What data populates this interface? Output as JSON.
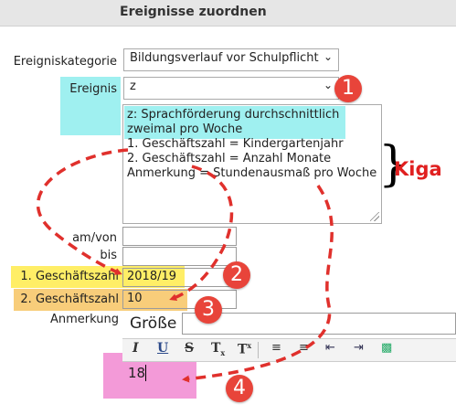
{
  "header": {
    "title": "Ereignisse zuordnen"
  },
  "form": {
    "kategorie": {
      "label": "Ereigniskategorie",
      "value": "Bildungsverlauf vor Schulpflicht"
    },
    "ereignis": {
      "label": "Ereignis",
      "value": "z"
    },
    "description": {
      "lines": [
        "z: Sprachförderung durchschnittlich",
        "zweimal pro Woche",
        "1. Geschäftszahl = Kindergartenjahr",
        "2. Geschäftszahl = Anzahl Monate",
        "Anmerkung = Stundenausmaß pro Woche"
      ]
    },
    "amvon": {
      "label": "am/von",
      "value": ""
    },
    "bis": {
      "label": "bis",
      "value": ""
    },
    "gz1": {
      "label": "1. Geschäftszahl",
      "value": "2018/19"
    },
    "gz2": {
      "label": "2. Geschäftszahl",
      "value": "10"
    },
    "anmerkung": {
      "label": "Anmerkung"
    },
    "editor": {
      "size_label": "Größe",
      "content": "18",
      "toolbar": {
        "italic": "I",
        "underline": "U",
        "strike": "S",
        "subscript": "T",
        "superscript": "T"
      }
    }
  },
  "annotations": {
    "kiga_label": "Kiga",
    "badges": [
      "1",
      "2",
      "3",
      "4"
    ]
  },
  "colors": {
    "cyan_highlight": "#9ff0f0",
    "yellow_highlight": "#ffee66",
    "orange_highlight": "#f8cd7a",
    "pink_highlight": "#f39ad8",
    "badge_red": "#e8443a",
    "arrow_red": "#e0302c"
  }
}
